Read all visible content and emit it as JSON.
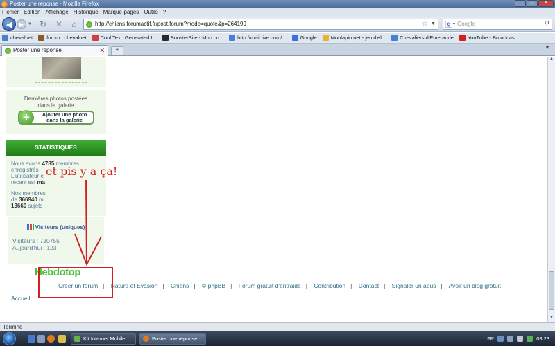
{
  "window": {
    "title": "Poster une réponse - Mozilla Firefox"
  },
  "menu": [
    "Fichier",
    "Edition",
    "Affichage",
    "Historique",
    "Marque-pages",
    "Outils",
    "?"
  ],
  "nav": {
    "url": "http://chiens.forumactif.fr/post.forum?mode=quote&p=264199",
    "search_placeholder": "Google"
  },
  "bookmarks": [
    {
      "label": "chevalnet",
      "color": "#4a7fd4"
    },
    {
      "label": "forum : chevalnet",
      "color": "#8a5a2a"
    },
    {
      "label": "Cool Text: Generated I...",
      "color": "#d04040"
    },
    {
      "label": "BoosterSite - Mon co...",
      "color": "#2a2a2a"
    },
    {
      "label": "http://mail.live.com/...",
      "color": "#4a7fd4"
    },
    {
      "label": "Google",
      "color": "#3a6ee8"
    },
    {
      "label": "Monlapin.net - jeu d'él...",
      "color": "#e8b23a"
    },
    {
      "label": "Chevaliers d'Emeraude",
      "color": "#4a7fd4"
    },
    {
      "label": "YouTube - Broadcast ...",
      "color": "#d02020"
    }
  ],
  "tab": {
    "label": "Poster une réponse"
  },
  "sidebar": {
    "gallery_caption_1": "Dernières photos postées",
    "gallery_caption_2": "dans la galerie",
    "add_photo_1": "Ajouter une photo",
    "add_photo_2": "dans la galerie",
    "stats_title": "STATISTIQUES",
    "stats_l1_pre": "Nous avons ",
    "stats_l1_num": "4785",
    "stats_l1_post": " membres",
    "stats_l2": "enregistrés",
    "stats_l3": "L'utilisateur e",
    "stats_l4_pre": "récent est ",
    "stats_l4_b": "ma",
    "stats_m1": "Nos membres",
    "stats_m2_pre": "de ",
    "stats_m2_num": "366940",
    "stats_m2_post": " m",
    "stats_m3_num": "13660",
    "stats_m3_post": " sujets",
    "visitors_title": "Visiteurs (uniques)",
    "visitors_total": "Visiteurs : 720755",
    "visitors_today": "Aujourd'hui : 123"
  },
  "footer": {
    "hebdotop": "Hebdotop",
    "links": [
      "Créer un forum",
      "Nature et Evasion",
      "Chiens",
      "© phpBB",
      "Forum gratuit d'entraide",
      "Contribution",
      "Contact",
      "Signaler un abus",
      "Avoir un blog gratuit"
    ],
    "accueil": "Accueil"
  },
  "annotation": {
    "text": "et pis y a ça!",
    "color": "#d22121"
  },
  "status": {
    "text": "Terminé"
  },
  "taskbar": {
    "tasks": [
      "Kit Internet Mobile ...",
      "Poster une réponse ..."
    ],
    "lang": "FR",
    "clock": "03:23"
  }
}
